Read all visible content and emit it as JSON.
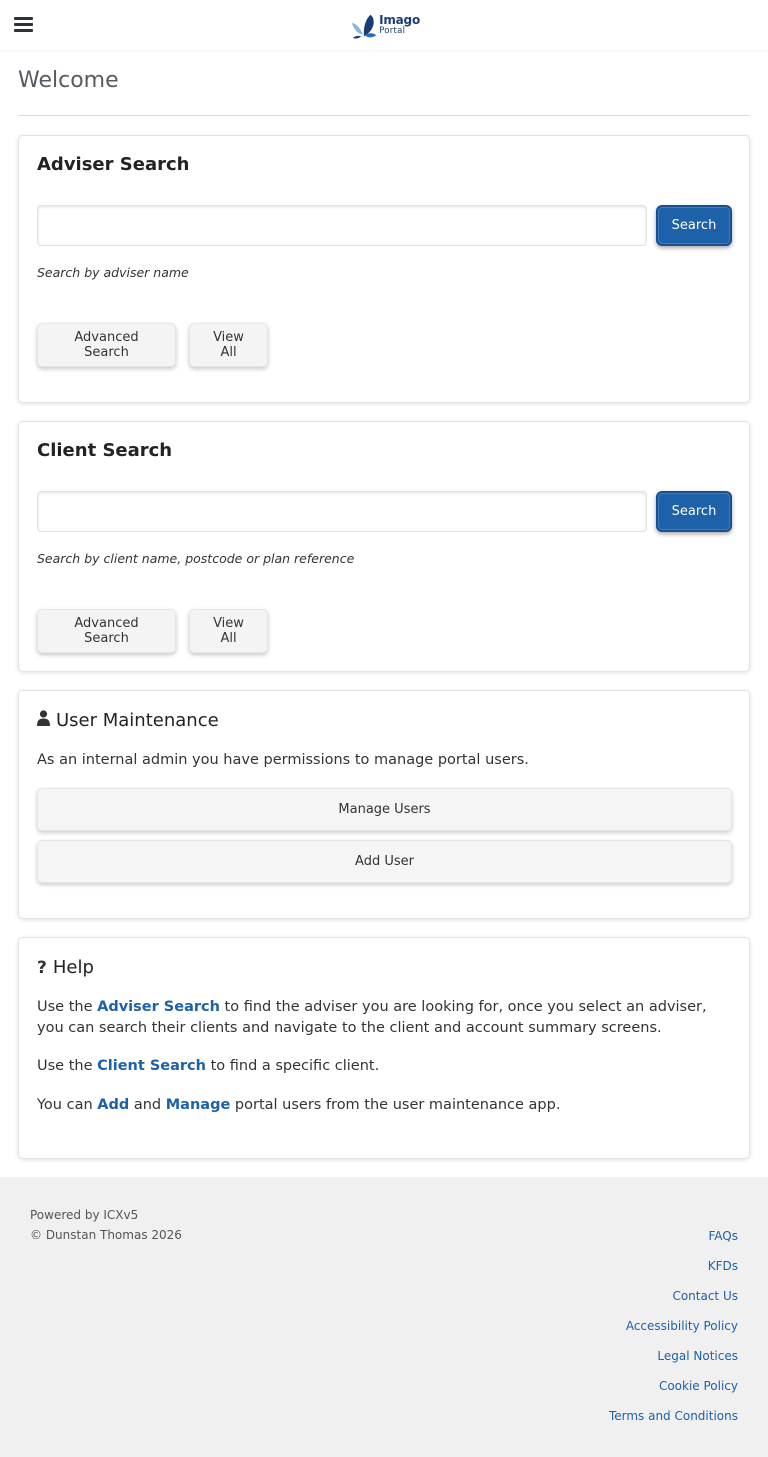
{
  "header": {
    "menu_icon": "hamburger-menu-icon",
    "logo": {
      "main": "Imago",
      "sub": "Portal",
      "brand_color": "#1b3d76"
    }
  },
  "page": {
    "title": "Welcome"
  },
  "adviser_search": {
    "title": "Adviser Search",
    "input_value": "",
    "search_label": "Search",
    "hint": "Search by adviser name",
    "advanced_label": "Advanced Search",
    "view_all_label": "View All"
  },
  "client_search": {
    "title": "Client Search",
    "input_value": "",
    "search_label": "Search",
    "hint": "Search by client name, postcode or plan reference",
    "advanced_label": "Advanced Search",
    "view_all_label": "View All"
  },
  "user_maintenance": {
    "icon": "user-icon",
    "title": "User Maintenance",
    "description": "As an internal admin you have permissions to manage portal users.",
    "manage_label": "Manage Users",
    "add_label": "Add User"
  },
  "help": {
    "icon": "question-icon",
    "title": "Help",
    "p1_a": "Use the ",
    "p1_link": "Adviser Search",
    "p1_b": " to find the adviser you are looking for, once you select an adviser, you can search their clients and navigate to the client and account summary screens.",
    "p2_a": "Use the ",
    "p2_link": "Client Search",
    "p2_b": " to find a specific client.",
    "p3_a": "You can ",
    "p3_link1": "Add",
    "p3_mid": " and ",
    "p3_link2": "Manage",
    "p3_b": " portal users from the user maintenance app."
  },
  "footer": {
    "powered": "Powered by ICXv5",
    "copyright": "© Dunstan Thomas 2026",
    "links": [
      "FAQs",
      "KFDs",
      "Contact Us",
      "Accessibility Policy",
      "Legal Notices",
      "Cookie Policy",
      "Terms and Conditions"
    ]
  },
  "colors": {
    "primary": "#1d61a8",
    "link": "#1d61a8"
  }
}
